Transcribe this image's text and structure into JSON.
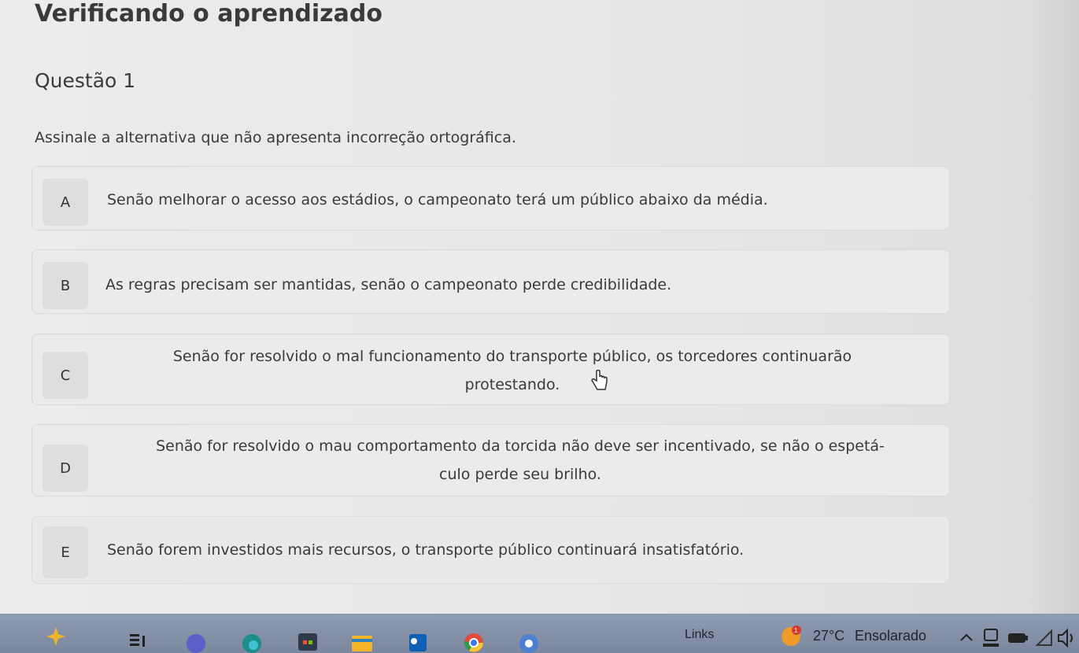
{
  "page": {
    "title": "Verificando o aprendizado"
  },
  "question": {
    "title": "Questão 1",
    "prompt": "Assinale a alternativa que não apresenta incorreção ortográfica."
  },
  "options": [
    {
      "letter": "A",
      "text": "Senão melhorar o acesso aos estádios, o campeonato terá um público abaixo da média."
    },
    {
      "letter": "B",
      "text": "As regras precisam ser mantidas, senão o campeonato perde credibilidade."
    },
    {
      "letter": "C",
      "line1": "Senão for resolvido o mal funcionamento do transporte público, os torcedores continuarão",
      "line2": "protestando."
    },
    {
      "letter": "D",
      "line1": "Senão for resolvido o mau comportamento da torcida não deve ser incentivado, se não o espetá-",
      "line2": "culo perde seu brilho."
    },
    {
      "letter": "E",
      "text": "Senão forem investidos mais recursos, o transporte público continuará insatisfatório."
    }
  ],
  "taskbar": {
    "links_label": "Links",
    "temperature": "27°C",
    "weather": "Ensolarado",
    "weather_badge": "1",
    "icons": [
      "copilot-icon",
      "task-view-icon",
      "teams-icon",
      "edge-icon",
      "store-icon",
      "file-explorer-icon",
      "outlook-icon",
      "chrome-icon",
      "google-app-icon",
      "weather-sun-icon",
      "chevron-up-icon",
      "keyboard-icon",
      "wifi-icon",
      "volume-icon"
    ]
  }
}
